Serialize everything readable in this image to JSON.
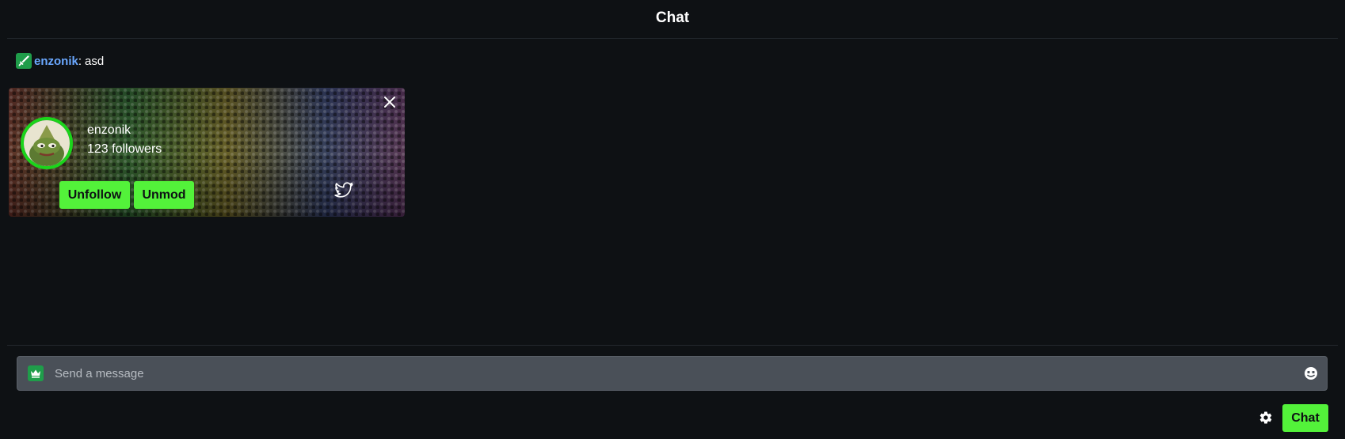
{
  "header": {
    "title": "Chat"
  },
  "messages": [
    {
      "badge_icon": "sword-icon",
      "username": "enzonik",
      "separator": ":",
      "text": "asd",
      "username_color": "#6aa8ff"
    }
  ],
  "user_card": {
    "name": "enzonik",
    "followers_text": "123 followers",
    "unfollow_label": "Unfollow",
    "unmod_label": "Unmod",
    "avatar_ring_color": "#1bd41b",
    "close_icon": "close-icon",
    "social_icon": "twitter-icon"
  },
  "composer": {
    "badge_icon": "crown-icon",
    "placeholder": "Send a message",
    "value": "",
    "emote_icon": "emote-icon",
    "settings_icon": "gear-icon",
    "send_label": "Chat"
  },
  "colors": {
    "accent": "#53f23a",
    "background": "#0e1114",
    "badge": "#1f9d4a",
    "input_bg": "#4a5058"
  }
}
